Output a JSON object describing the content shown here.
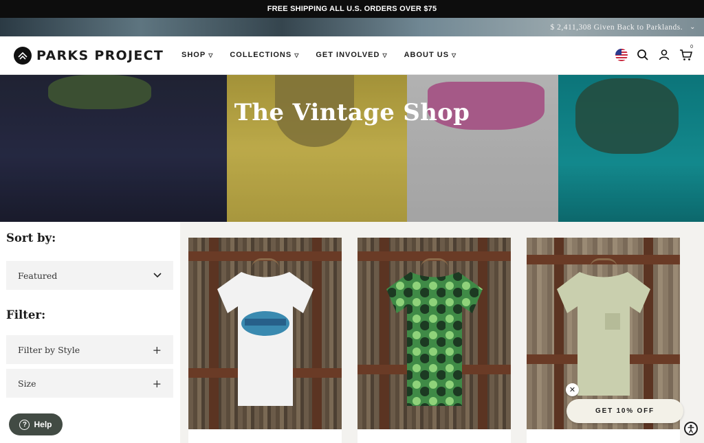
{
  "promo_bar": {
    "text": "FREE SHIPPING ALL U.S. ORDERS OVER $75"
  },
  "impact_bar": {
    "text": "$ 2,411,308 Given Back to Parklands."
  },
  "header": {
    "logo_text": "PARKS PROJECT",
    "nav": [
      {
        "label": "SHOP"
      },
      {
        "label": "COLLECTIONS"
      },
      {
        "label": "GET INVOLVED"
      },
      {
        "label": "ABOUT US"
      }
    ],
    "cart_count": "0",
    "icons": [
      "us-flag-icon",
      "search-icon",
      "account-icon",
      "cart-icon"
    ]
  },
  "hero": {
    "title": "The Vintage Shop"
  },
  "sidebar": {
    "sort_heading": "Sort by:",
    "sort_value": "Featured",
    "filter_heading": "Filter:",
    "filters": [
      {
        "label": "Filter by Style"
      },
      {
        "label": "Size"
      }
    ]
  },
  "products": [
    {
      "image": "white-ocean-city-tee"
    },
    {
      "image": "green-tie-dye-tee"
    },
    {
      "image": "sage-pocket-tee"
    }
  ],
  "widgets": {
    "help_label": "Help",
    "discount_label": "GET 10% OFF",
    "close_symbol": "✕"
  }
}
